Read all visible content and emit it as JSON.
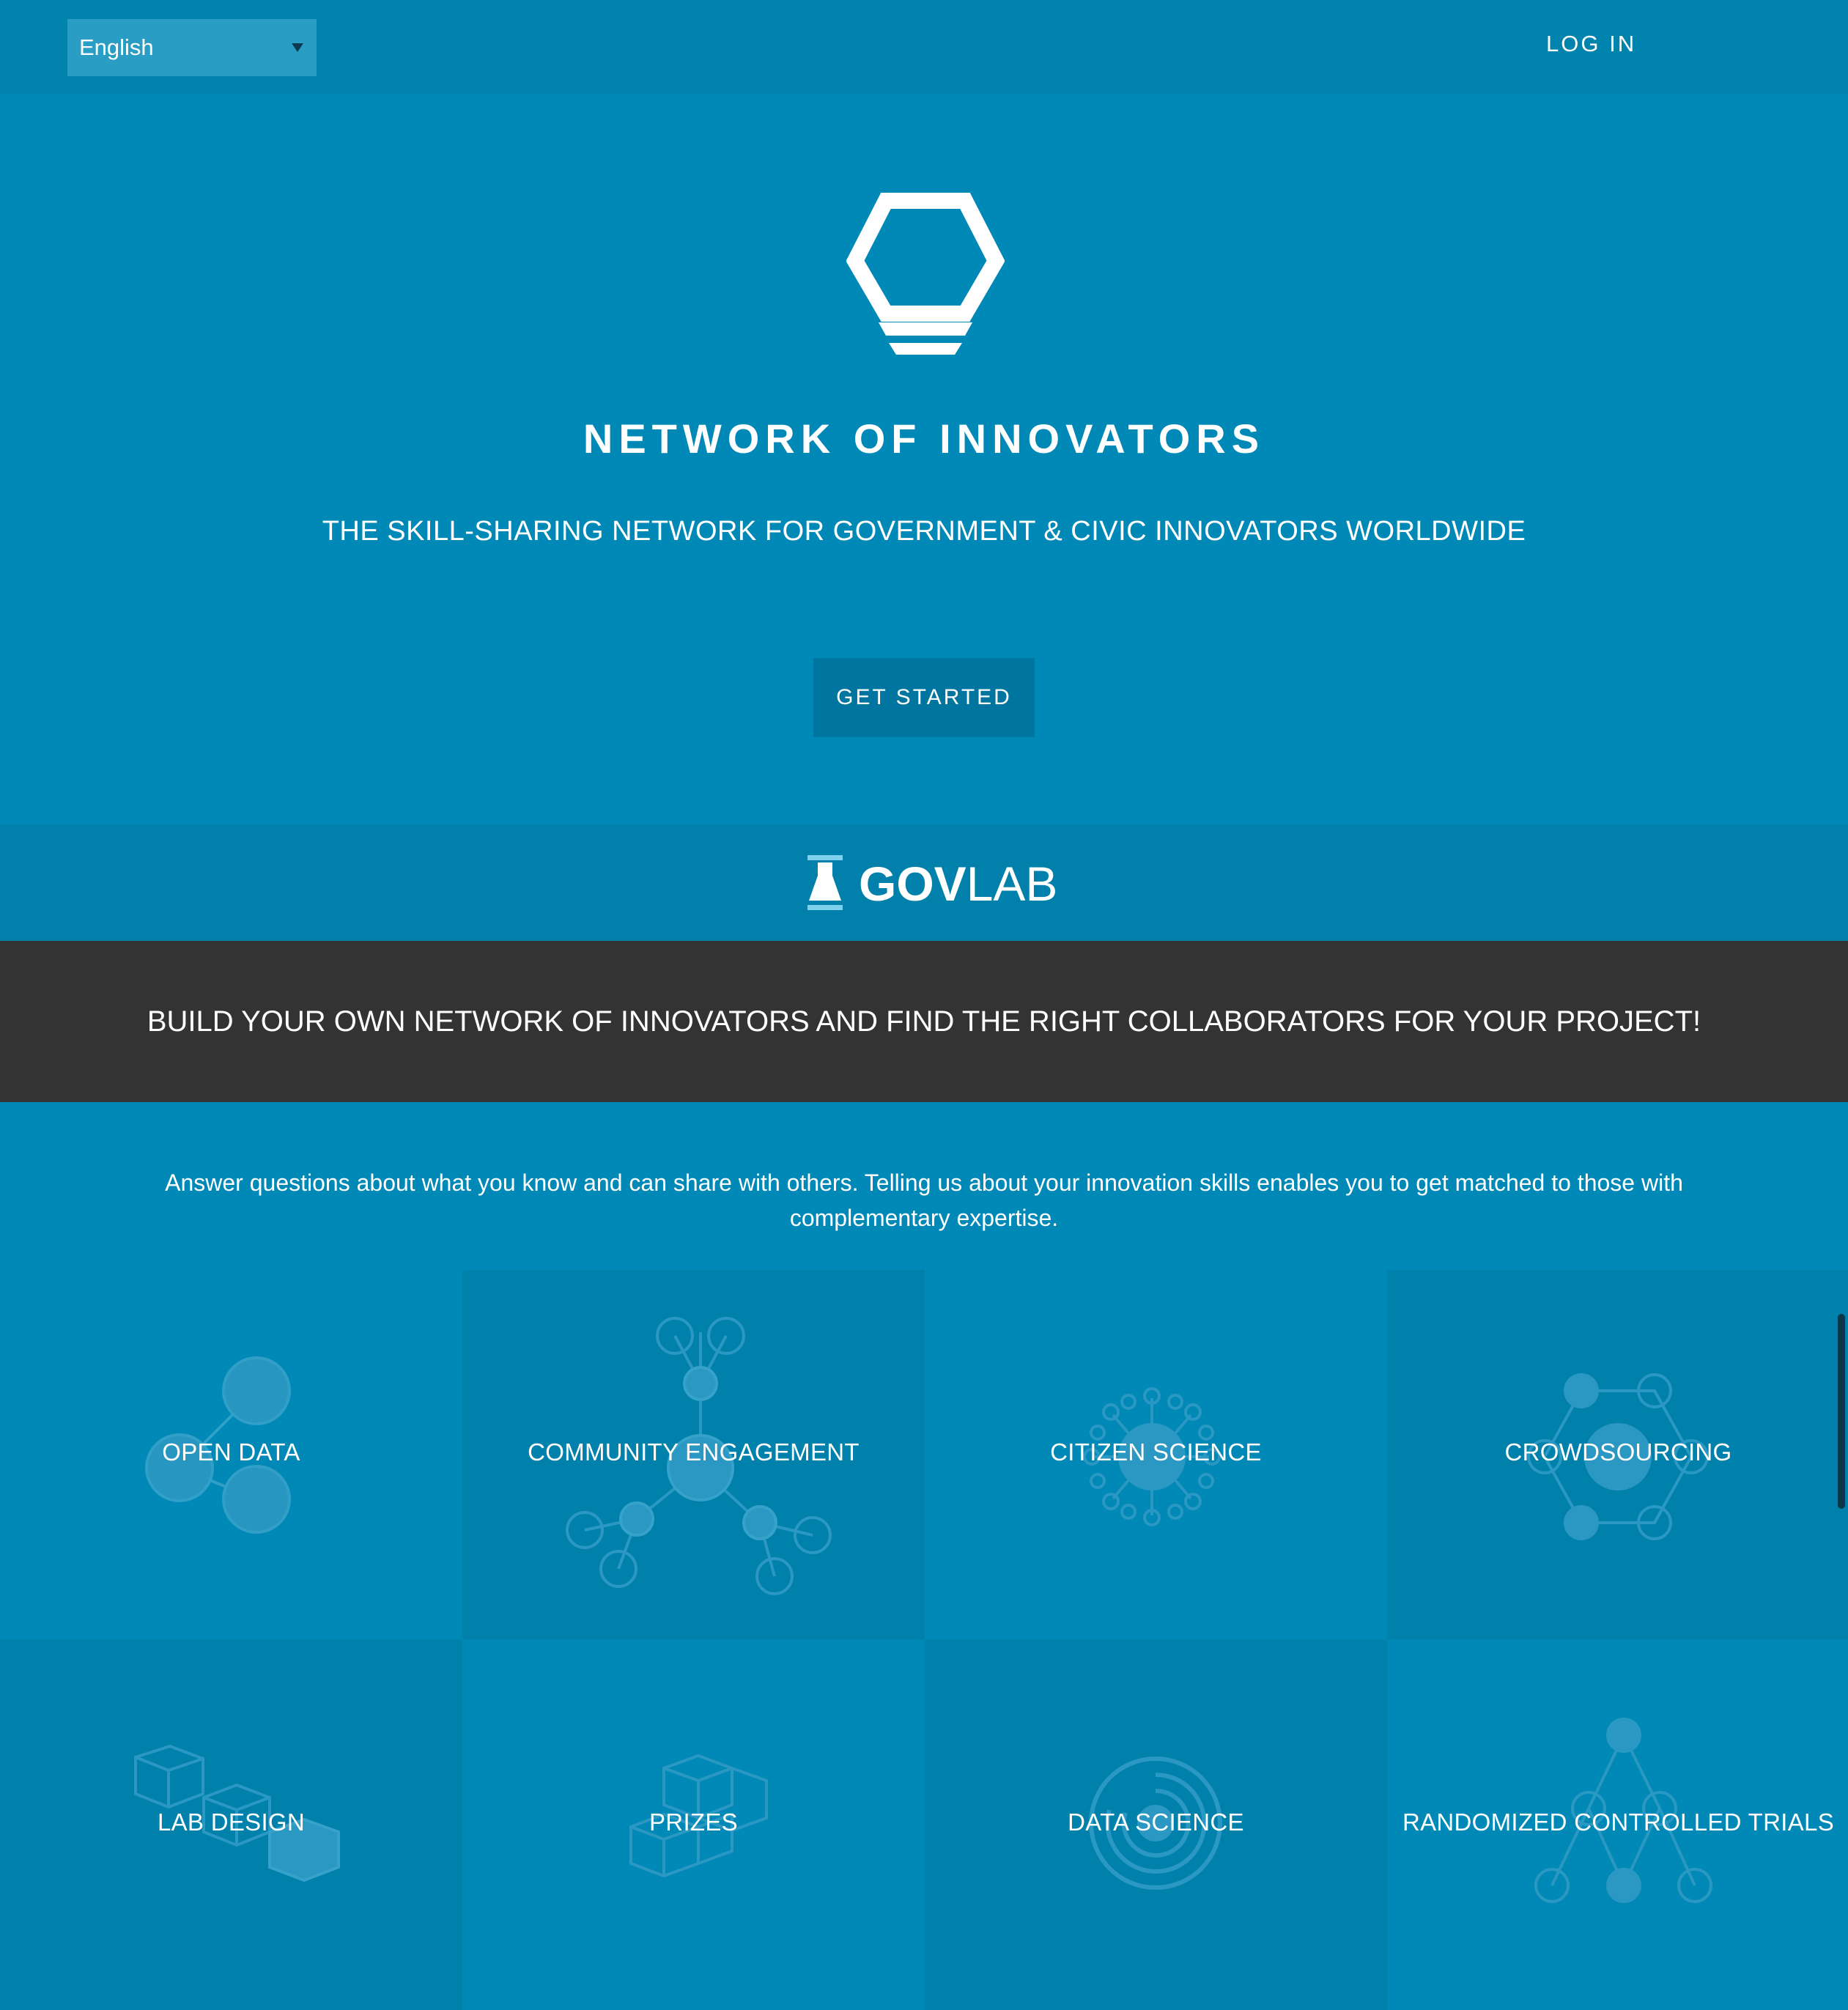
{
  "header": {
    "language": "English",
    "login_label": "LOG IN"
  },
  "hero": {
    "title": "NETWORK OF INNOVATORS",
    "subtitle": "THE SKILL-SHARING NETWORK FOR GOVERNMENT & CIVIC INNOVATORS WORLDWIDE",
    "cta_label": "GET STARTED"
  },
  "govlab": {
    "bold": "GOV",
    "light": "LAB"
  },
  "banner": {
    "text": "BUILD YOUR OWN NETWORK OF INNOVATORS AND FIND THE RIGHT COLLABORATORS FOR YOUR PROJECT!"
  },
  "intro": {
    "text": "Answer questions about what you know and can share with others. Telling us about your innovation skills enables you to get matched to those with complementary expertise."
  },
  "topics": [
    {
      "label": "OPEN DATA",
      "icon": "open-data-icon"
    },
    {
      "label": "COMMUNITY ENGAGEMENT",
      "icon": "community-engagement-icon"
    },
    {
      "label": "CITIZEN SCIENCE",
      "icon": "citizen-science-icon"
    },
    {
      "label": "CROWDSOURCING",
      "icon": "crowdsourcing-icon"
    },
    {
      "label": "LAB DESIGN",
      "icon": "lab-design-icon"
    },
    {
      "label": "PRIZES",
      "icon": "prizes-icon"
    },
    {
      "label": "DATA SCIENCE",
      "icon": "data-science-icon"
    },
    {
      "label": "RANDOMIZED CONTROLLED TRIALS",
      "icon": "randomized-controlled-trials-icon"
    }
  ],
  "colors": {
    "background": "#0088b6",
    "tile_dark": "#0081ac",
    "banner_dark": "#333333",
    "cta": "#00759f"
  }
}
